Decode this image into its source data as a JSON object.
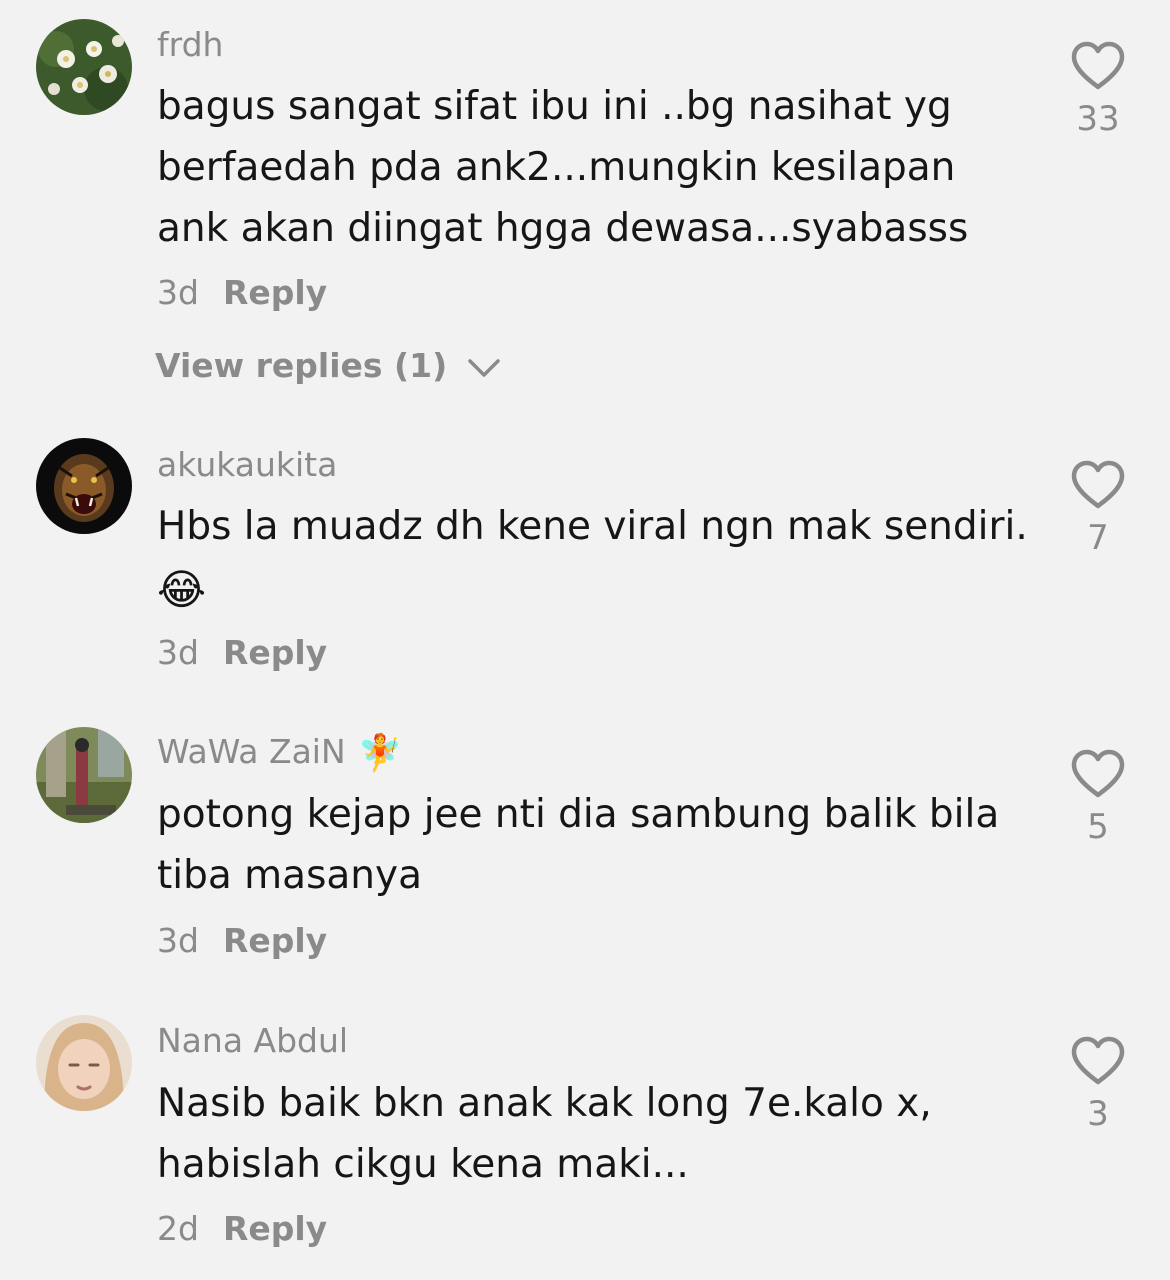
{
  "comments": [
    {
      "username": "frdh",
      "text": "bagus sangat sifat ibu ini ..bg nasihat yg berfaedah pda ank2...mungkin kesilapan ank akan diingat hgga dewasa...syabasss",
      "time": "3d",
      "reply_label": "Reply",
      "likes": "33",
      "view_replies": "View replies (1)"
    },
    {
      "username": "akukaukita",
      "text": "Hbs la muadz dh kene viral ngn mak sendiri.",
      "emoji": "😂",
      "time": "3d",
      "reply_label": "Reply",
      "likes": "7"
    },
    {
      "username": "WaWa ZaiN",
      "flair": "🧚",
      "text": "potong kejap jee nti dia sambung balik bila tiba masanya",
      "time": "3d",
      "reply_label": "Reply",
      "likes": "5"
    },
    {
      "username": "Nana Abdul",
      "text": "Nasib baik bkn anak kak long 7e.kalo x, habislah cikgu kena maki...",
      "time": "2d",
      "reply_label": "Reply",
      "likes": "3"
    }
  ],
  "icons": {
    "like": "heart-outline-icon",
    "expand": "chevron-down-icon"
  },
  "colors": {
    "background": "#f2f2f2",
    "secondary_text": "#8a8a8a",
    "primary_text": "#161616"
  }
}
